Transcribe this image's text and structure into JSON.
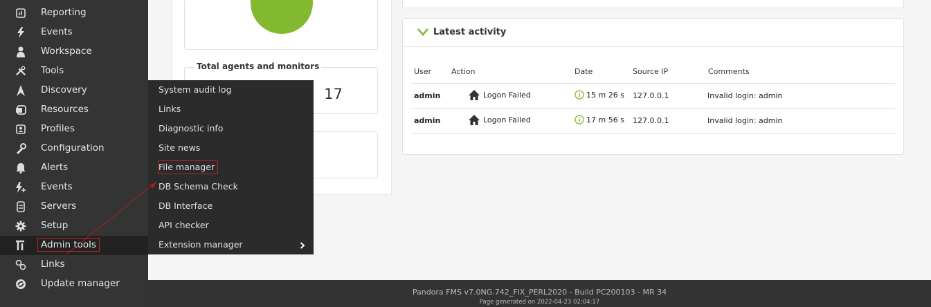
{
  "sidebar": {
    "items": [
      {
        "label": "Reporting",
        "icon": "reporting-icon"
      },
      {
        "label": "Events",
        "icon": "lightning-icon"
      },
      {
        "label": "Workspace",
        "icon": "user-icon"
      },
      {
        "label": "Tools",
        "icon": "tools-icon"
      },
      {
        "label": "Discovery",
        "icon": "discovery-icon"
      },
      {
        "label": "Resources",
        "icon": "resources-icon"
      },
      {
        "label": "Profiles",
        "icon": "profile-icon"
      },
      {
        "label": "Configuration",
        "icon": "wrench-icon"
      },
      {
        "label": "Alerts",
        "icon": "bell-icon"
      },
      {
        "label": "Events",
        "icon": "lightning-plus-icon"
      },
      {
        "label": "Servers",
        "icon": "server-icon"
      },
      {
        "label": "Setup",
        "icon": "gear-icon"
      },
      {
        "label": "Admin tools",
        "icon": "admin-tools-icon"
      },
      {
        "label": "Links",
        "icon": "link-icon"
      },
      {
        "label": "Update manager",
        "icon": "update-icon"
      }
    ]
  },
  "submenu": {
    "items": [
      {
        "label": "System audit log"
      },
      {
        "label": "Links"
      },
      {
        "label": "Diagnostic info"
      },
      {
        "label": "Site news"
      },
      {
        "label": "File manager"
      },
      {
        "label": "DB Schema Check"
      },
      {
        "label": "DB Interface"
      },
      {
        "label": "API checker"
      },
      {
        "label": "Extension manager"
      }
    ]
  },
  "agents": {
    "title": "Total agents and monitors",
    "count": "17"
  },
  "activity": {
    "title": "Latest activity",
    "headers": [
      "User",
      "Action",
      "Date",
      "Source IP",
      "Comments"
    ],
    "rows": [
      {
        "user": "admin",
        "action": "Logon Failed",
        "date": "15 m 26 s",
        "ip": "127.0.0.1",
        "comment": "Invalid login: admin"
      },
      {
        "user": "admin",
        "action": "Logon Failed",
        "date": "17 m 56 s",
        "ip": "127.0.0.1",
        "comment": "Invalid login: admin"
      }
    ]
  },
  "footer": {
    "version": "Pandora FMS v7.0NG.742_FIX_PERL2020 - Build PC200103 - MR 34",
    "generated": "Page generated on 2022-04-23 02:04:17"
  },
  "colors": {
    "accent_green": "#82b92e",
    "highlight_red": "#b22222"
  }
}
